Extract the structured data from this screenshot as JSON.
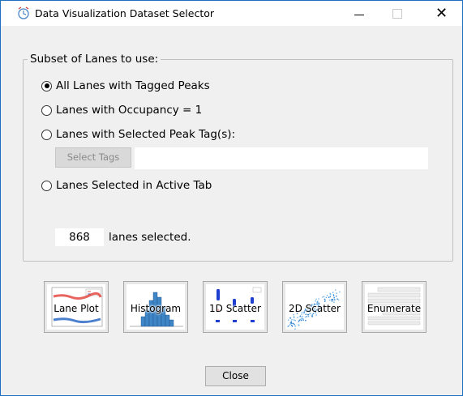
{
  "window": {
    "title": "Data Visualization Dataset Selector",
    "close_glyph": "✕"
  },
  "subset": {
    "legend": "Subset of Lanes to use:",
    "options": [
      {
        "label": "All Lanes with Tagged Peaks",
        "checked": true
      },
      {
        "label": "Lanes with Occupancy = 1",
        "checked": false
      },
      {
        "label": "Lanes with Selected Peak Tag(s):",
        "checked": false
      },
      {
        "label": "Lanes Selected in Active Tab",
        "checked": false
      }
    ],
    "select_tags_label": "Select Tags",
    "tags_value": "",
    "count_value": "868",
    "count_label": "lanes selected."
  },
  "visualizations": [
    {
      "label": "Lane Plot",
      "icon": "lane-plot-thumbnail"
    },
    {
      "label": "Histogram",
      "icon": "histogram-thumbnail"
    },
    {
      "label": "1D Scatter",
      "icon": "1d-scatter-thumbnail"
    },
    {
      "label": "2D Scatter",
      "icon": "2d-scatter-thumbnail"
    },
    {
      "label": "Enumerate",
      "icon": "table-thumbnail"
    }
  ],
  "footer": {
    "close_label": "Close"
  },
  "colors": {
    "window_border": "#1e6fbf",
    "dialog_bg": "#f0f0f0",
    "plot_blue": "#1f5fbf",
    "plot_red": "#e0302a"
  }
}
